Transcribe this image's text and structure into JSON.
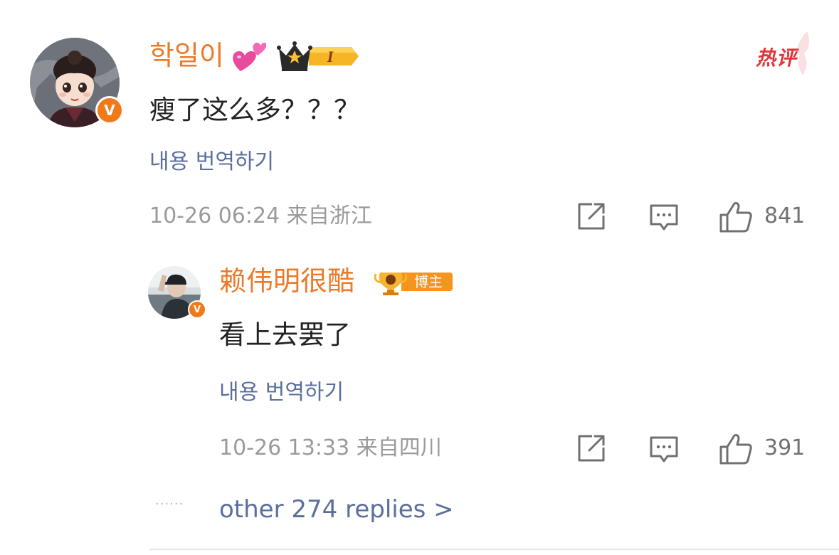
{
  "main_comment": {
    "username": "학일이",
    "emoji_icon": "two-hearts-emoji",
    "vip_badge": {
      "icon": "crown-vip-badge",
      "level": "I"
    },
    "verified_badge": "V",
    "hot_label": "热评",
    "text": "瘦了这么多？？？",
    "translate_label": "내용 번역하기",
    "timestamp": "10-26 06:24",
    "location": "来自浙江",
    "actions": {
      "share_icon": "share-icon",
      "reply_icon": "comment-icon",
      "like_icon": "thumbs-up-icon",
      "like_count": "841"
    }
  },
  "reply": {
    "username": "赖伟明很酷",
    "blogger_badge": {
      "icon": "trophy-badge",
      "label": "博主"
    },
    "verified_badge": "V",
    "text": "看上去罢了",
    "translate_label": "내용 번역하기",
    "timestamp": "10-26 13:33",
    "location": "来自四川",
    "actions": {
      "share_icon": "share-icon",
      "reply_icon": "comment-icon",
      "like_icon": "thumbs-up-icon",
      "like_count": "391"
    }
  },
  "more_replies": {
    "dots": "······",
    "label": "other 274 replies >"
  },
  "colors": {
    "username": "#eb7a2a",
    "link": "#5b6f9e",
    "meta": "#9a9a9a",
    "hot": "#e0353a",
    "verified": "#f07a1a"
  }
}
